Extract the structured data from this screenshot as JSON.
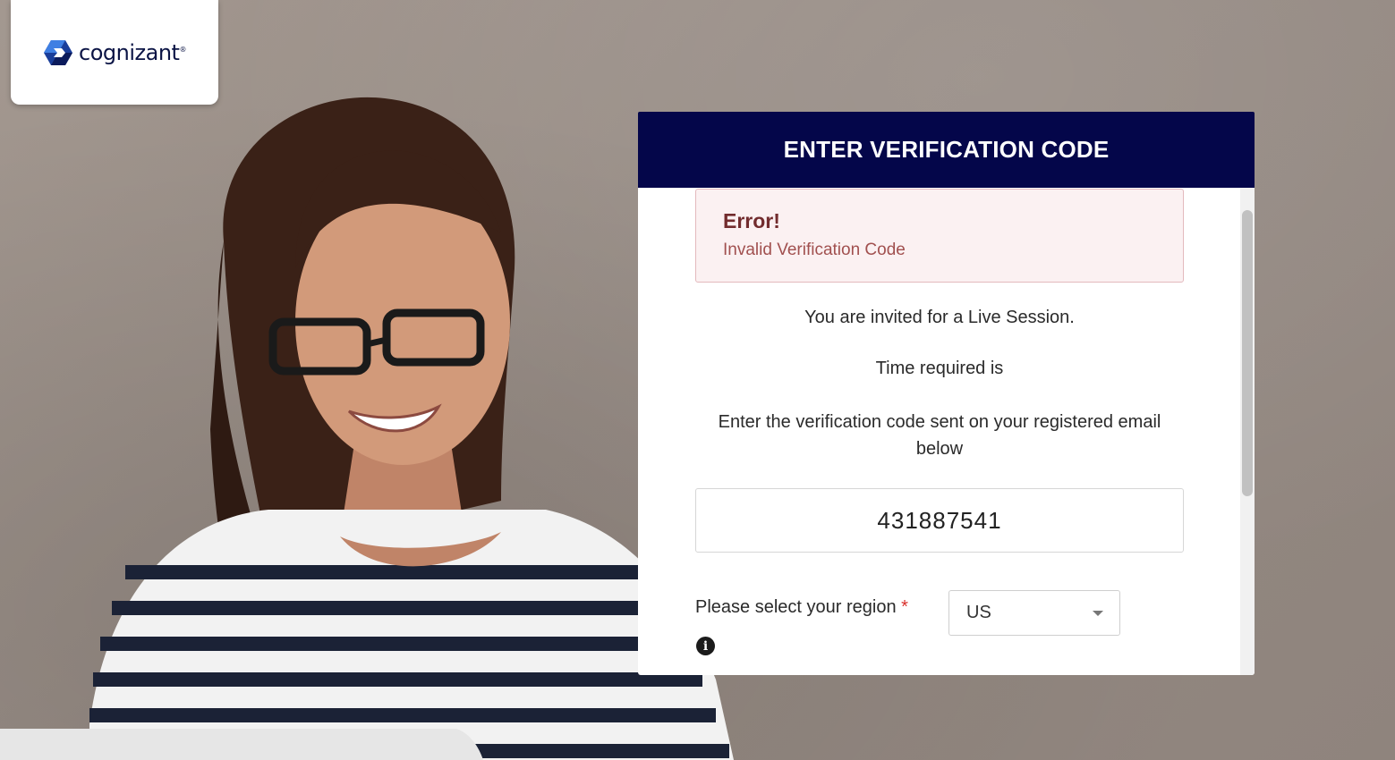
{
  "logo": {
    "text": "cognizant",
    "tm": "®"
  },
  "panel": {
    "title": "ENTER VERIFICATION CODE"
  },
  "alert": {
    "title": "Error!",
    "message": "Invalid Verification Code"
  },
  "messages": {
    "invite": "You are invited for a Live Session.",
    "time": "Time required is",
    "instruction_line1": "Enter the verification code sent on your registered email",
    "instruction_line2": "below"
  },
  "code_input": {
    "value": "431887541"
  },
  "region": {
    "label": "Please select your region",
    "required_marker": "*",
    "selected": "US"
  },
  "colors": {
    "header_bg": "#04064a",
    "alert_bg": "#fbf1f2",
    "alert_title": "#722c2e",
    "alert_text": "#a1504f",
    "required": "#d9302c"
  }
}
